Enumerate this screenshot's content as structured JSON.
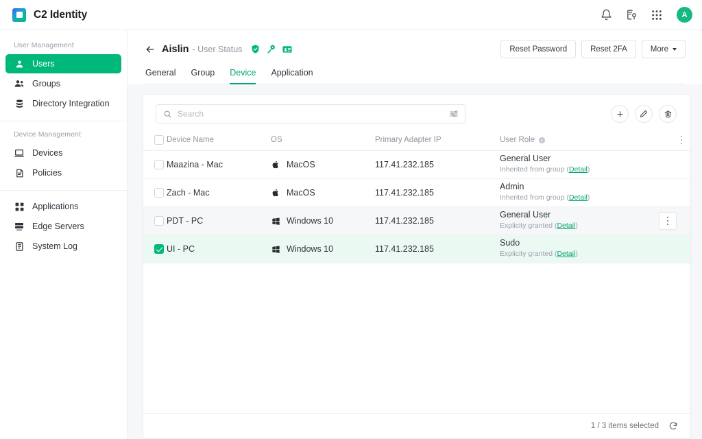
{
  "topbar": {
    "brand": "C2 Identity",
    "logo_icon": "c2-logo-icon",
    "notifications_icon": "bell-icon",
    "device_locate_icon": "device-location-icon",
    "apps_icon": "apps-grid-icon",
    "avatar_initial": "A"
  },
  "sidebar": {
    "groups": [
      {
        "label": "User Management",
        "items": [
          {
            "label": "Users",
            "icon": "user-icon",
            "active": true
          },
          {
            "label": "Groups",
            "icon": "users-group-icon",
            "active": false
          },
          {
            "label": "Directory Integration",
            "icon": "database-icon",
            "active": false
          }
        ]
      },
      {
        "label": "Device Management",
        "items": [
          {
            "label": "Devices",
            "icon": "laptop-icon",
            "active": false
          },
          {
            "label": "Policies",
            "icon": "policy-document-icon",
            "active": false
          }
        ]
      },
      {
        "label": "",
        "items": [
          {
            "label": "Applications",
            "icon": "applications-grid-icon",
            "active": false
          },
          {
            "label": "Edge Servers",
            "icon": "server-icon",
            "active": false
          },
          {
            "label": "System Log",
            "icon": "log-book-icon",
            "active": false
          }
        ]
      }
    ]
  },
  "page": {
    "back_icon": "back-arrow-icon",
    "user_name": "Aislin",
    "subtitle": "- User Status",
    "status_badges": [
      {
        "icon": "shield-check-icon",
        "color": "#00b87c"
      },
      {
        "icon": "key-icon",
        "color": "#00b87c"
      },
      {
        "icon": "id-card-icon",
        "color": "#00b87c"
      }
    ],
    "actions": {
      "reset_password": "Reset Password",
      "reset_2fa": "Reset 2FA",
      "more": "More"
    },
    "tabs": [
      {
        "label": "General",
        "active": false
      },
      {
        "label": "Group",
        "active": false
      },
      {
        "label": "Device",
        "active": true
      },
      {
        "label": "Application",
        "active": false
      }
    ]
  },
  "toolbar": {
    "search_placeholder": "Search",
    "search_value": "",
    "search_icon": "search-icon",
    "filter_icon": "filter-sliders-icon",
    "add_icon": "plus-icon",
    "edit_icon": "pencil-icon",
    "delete_icon": "trash-icon"
  },
  "table": {
    "headers": {
      "device_name": "Device Name",
      "os": "OS",
      "ip": "Primary Adapter IP",
      "role": "User Role",
      "role_info_icon": "info-icon",
      "column_menu_icon": "kebab-menu-icon"
    },
    "rows": [
      {
        "selected": false,
        "hovered": false,
        "device_name": "Maazina - Mac",
        "os": "MacOS",
        "os_icon": "apple-icon",
        "ip": "117.41.232.185",
        "role": "General User",
        "role_note": "Inherited from group (",
        "role_link": "Detail",
        "role_note_end": ")"
      },
      {
        "selected": false,
        "hovered": false,
        "device_name": "Zach - Mac",
        "os": "MacOS",
        "os_icon": "apple-icon",
        "ip": "117.41.232.185",
        "role": "Admin",
        "role_note": "Inherited from group (",
        "role_link": "Detail",
        "role_note_end": ")"
      },
      {
        "selected": false,
        "hovered": true,
        "device_name": "PDT - PC",
        "os": "Windows 10",
        "os_icon": "windows-icon",
        "ip": "117.41.232.185",
        "role": "General User",
        "role_note": "Explicity granted (",
        "role_link": "Detail",
        "role_note_end": ")"
      },
      {
        "selected": true,
        "hovered": false,
        "device_name": "UI - PC",
        "os": "Windows 10",
        "os_icon": "windows-icon",
        "ip": "117.41.232.185",
        "role": "Sudo",
        "role_note": "Explicity granted (",
        "role_link": "Detail",
        "role_note_end": ")"
      }
    ]
  },
  "footer": {
    "selection_text": "1 / 3 items selected",
    "refresh_icon": "refresh-icon"
  },
  "colors": {
    "accent": "#00b87c",
    "accent_dark": "#00a870",
    "selected_row": "#ebf9f3",
    "hover_row": "#f6f7f8"
  }
}
